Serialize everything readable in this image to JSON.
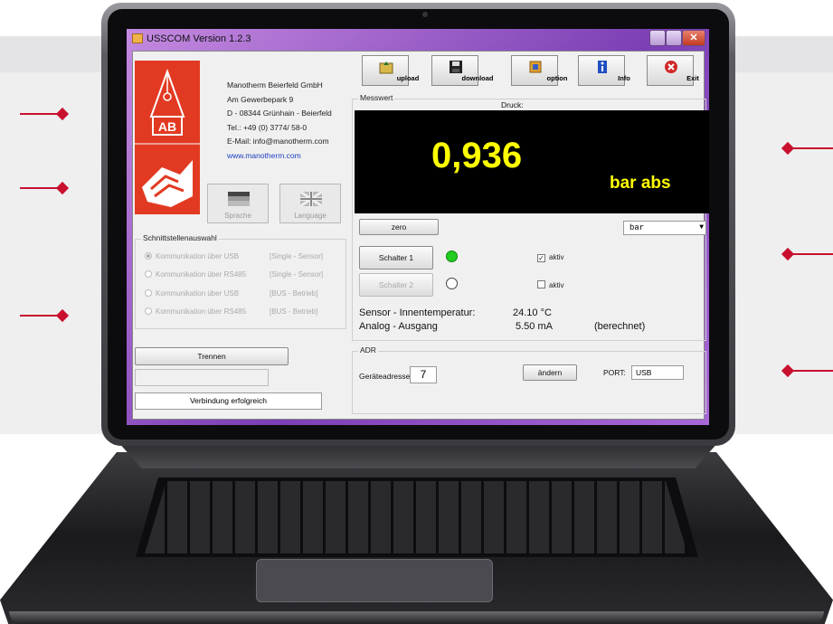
{
  "window": {
    "title": "USSCOM Version 1.2.3"
  },
  "company": {
    "lines": [
      "Manotherm Beierfeld GmbH",
      "Am Gewerbepark 9",
      "D - 08344 Grünhain - Beierfeld",
      "Tel.: +49 (0) 3774/ 58-0",
      "E-Mail: info@manotherm.com"
    ],
    "web": "www.manotherm.com"
  },
  "language": {
    "german": "Sprache",
    "english": "Language"
  },
  "interface": {
    "title": "Schnittstellenauswahl",
    "options": [
      {
        "label": "Kommunikation über USB",
        "mode": "[Single - Sensor]"
      },
      {
        "label": "Kommunikation über RS485",
        "mode": "[Single - Sensor]"
      },
      {
        "label": "Kommunikation über USB",
        "mode": "[BUS - Betrieb]"
      },
      {
        "label": "Kommunikation über RS485",
        "mode": "[BUS - Betrieb]"
      }
    ]
  },
  "connection": {
    "disconnect_label": "Trennen",
    "status": "Verbindung erfolgreich"
  },
  "toolbar": {
    "upload": "upload",
    "download": "download",
    "option": "option",
    "info": "Info",
    "exit": "Exit"
  },
  "measure": {
    "group_title": "Messwert",
    "pressure_title": "Druck:",
    "value": "0,936",
    "unit": "bar abs",
    "zero_label": "zero",
    "unit_select": "bar"
  },
  "switches": [
    {
      "label": "Schalter 1",
      "state_color": "#22cc22",
      "active_label": "aktiv",
      "checked": "✓"
    },
    {
      "label": "Schalter 2",
      "state_color": "#ffffff",
      "active_label": "aktiv",
      "checked": ""
    }
  ],
  "readings": [
    {
      "label": "Sensor - Innentemperatur:",
      "value": "24.10 °C",
      "note": ""
    },
    {
      "label": "Analog - Ausgang",
      "value": "5.50 mA",
      "note": "(berechnet)"
    }
  ],
  "adr": {
    "group_title": "ADR",
    "address_label": "Geräteadresse:",
    "address": "7",
    "change_label": "ändern",
    "port_label": "PORT:",
    "port_value": "USB"
  },
  "colors": {
    "accent_red": "#c8102e",
    "display_bg": "#000000",
    "display_text": "#ffff00",
    "logo_red": "#e23a22"
  }
}
